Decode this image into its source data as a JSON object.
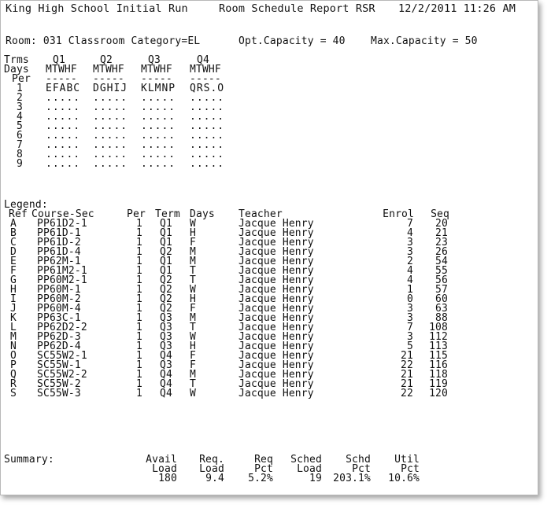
{
  "header": {
    "school": "King High School Initial Run",
    "report": "Room Schedule Report RSR",
    "datetime": "12/2/2011 11:26 AM"
  },
  "room_line": {
    "room": "Room: 031 Classroom Category=EL",
    "opt": "Opt.Capacity = 40",
    "max": "Max.Capacity = 50"
  },
  "grid": {
    "trms_label": "Trms",
    "days_label": "Days",
    "per_label": "Per",
    "terms": [
      "Q1",
      "Q2",
      "Q3",
      "Q4"
    ],
    "days": [
      "MTWHF",
      "MTWHF",
      "MTWHF",
      "MTWHF"
    ],
    "dashes": [
      "-----",
      "-----",
      "-----",
      "-----"
    ],
    "rows": [
      {
        "per": "1",
        "cells": [
          "EFABC",
          "DGHIJ",
          "KLMNP",
          "QRS.O"
        ]
      },
      {
        "per": "2",
        "cells": [
          ".....",
          ".....",
          ".....",
          "....."
        ]
      },
      {
        "per": "3",
        "cells": [
          ".....",
          ".....",
          ".....",
          "....."
        ]
      },
      {
        "per": "4",
        "cells": [
          ".....",
          ".....",
          ".....",
          "....."
        ]
      },
      {
        "per": "5",
        "cells": [
          ".....",
          ".....",
          ".....",
          "....."
        ]
      },
      {
        "per": "6",
        "cells": [
          ".....",
          ".....",
          ".....",
          "....."
        ]
      },
      {
        "per": "7",
        "cells": [
          ".....",
          ".....",
          ".....",
          "....."
        ]
      },
      {
        "per": "8",
        "cells": [
          ".....",
          ".....",
          ".....",
          "....."
        ]
      },
      {
        "per": "9",
        "cells": [
          ".....",
          ".....",
          ".....",
          "....."
        ]
      }
    ]
  },
  "legend": {
    "title": "Legend:",
    "headers": {
      "ref": "Ref",
      "course": "Course-Sec",
      "per": "Per",
      "term": "Term",
      "days": "Days",
      "teacher": "Teacher",
      "enrol": "Enrol",
      "seq": "Seq"
    },
    "rows": [
      {
        "ref": "A",
        "course": "PP61D2-1",
        "per": "1",
        "term": "Q1",
        "days": "W",
        "teacher": "Jacque Henry",
        "enrol": "7",
        "seq": "20"
      },
      {
        "ref": "B",
        "course": "PP61D-1",
        "per": "1",
        "term": "Q1",
        "days": "H",
        "teacher": "Jacque Henry",
        "enrol": "4",
        "seq": "21"
      },
      {
        "ref": "C",
        "course": "PP61D-2",
        "per": "1",
        "term": "Q1",
        "days": "F",
        "teacher": "Jacque Henry",
        "enrol": "3",
        "seq": "23"
      },
      {
        "ref": "D",
        "course": "PP61D-4",
        "per": "1",
        "term": "Q2",
        "days": "M",
        "teacher": "Jacque Henry",
        "enrol": "3",
        "seq": "26"
      },
      {
        "ref": "E",
        "course": "PP62M-1",
        "per": "1",
        "term": "Q1",
        "days": "M",
        "teacher": "Jacque Henry",
        "enrol": "2",
        "seq": "54"
      },
      {
        "ref": "F",
        "course": "PP61M2-1",
        "per": "1",
        "term": "Q1",
        "days": "T",
        "teacher": "Jacque Henry",
        "enrol": "4",
        "seq": "55"
      },
      {
        "ref": "G",
        "course": "PP60M2-1",
        "per": "1",
        "term": "Q2",
        "days": "T",
        "teacher": "Jacque Henry",
        "enrol": "4",
        "seq": "56"
      },
      {
        "ref": "H",
        "course": "PP60M-1",
        "per": "1",
        "term": "Q2",
        "days": "W",
        "teacher": "Jacque Henry",
        "enrol": "1",
        "seq": "57"
      },
      {
        "ref": "I",
        "course": "PP60M-2",
        "per": "1",
        "term": "Q2",
        "days": "H",
        "teacher": "Jacque Henry",
        "enrol": "0",
        "seq": "60"
      },
      {
        "ref": "J",
        "course": "PP60M-4",
        "per": "1",
        "term": "Q2",
        "days": "F",
        "teacher": "Jacque Henry",
        "enrol": "3",
        "seq": "63"
      },
      {
        "ref": "K",
        "course": "PP63C-1",
        "per": "1",
        "term": "Q3",
        "days": "M",
        "teacher": "Jacque Henry",
        "enrol": "3",
        "seq": "88"
      },
      {
        "ref": "L",
        "course": "PP62D2-2",
        "per": "1",
        "term": "Q3",
        "days": "T",
        "teacher": "Jacque Henry",
        "enrol": "7",
        "seq": "108"
      },
      {
        "ref": "M",
        "course": "PP62D-3",
        "per": "1",
        "term": "Q3",
        "days": "W",
        "teacher": "Jacque Henry",
        "enrol": "3",
        "seq": "112"
      },
      {
        "ref": "N",
        "course": "PP62D-4",
        "per": "1",
        "term": "Q3",
        "days": "H",
        "teacher": "Jacque Henry",
        "enrol": "5",
        "seq": "113"
      },
      {
        "ref": "O",
        "course": "SC55W2-1",
        "per": "1",
        "term": "Q4",
        "days": "F",
        "teacher": "Jacque Henry",
        "enrol": "21",
        "seq": "115"
      },
      {
        "ref": "P",
        "course": "SC55W-1",
        "per": "1",
        "term": "Q3",
        "days": "F",
        "teacher": "Jacque Henry",
        "enrol": "22",
        "seq": "116"
      },
      {
        "ref": "Q",
        "course": "SC55W2-2",
        "per": "1",
        "term": "Q4",
        "days": "M",
        "teacher": "Jacque Henry",
        "enrol": "21",
        "seq": "118"
      },
      {
        "ref": "R",
        "course": "SC55W-2",
        "per": "1",
        "term": "Q4",
        "days": "T",
        "teacher": "Jacque Henry",
        "enrol": "21",
        "seq": "119"
      },
      {
        "ref": "S",
        "course": "SC55W-3",
        "per": "1",
        "term": "Q4",
        "days": "W",
        "teacher": "Jacque Henry",
        "enrol": "22",
        "seq": "120"
      }
    ]
  },
  "summary": {
    "label": "Summary:",
    "columns": [
      {
        "h1": "Avail",
        "h2": "Load",
        "value": "180"
      },
      {
        "h1": "Req.",
        "h2": "Load",
        "value": "9.4"
      },
      {
        "h1": "Req",
        "h2": "Pct",
        "value": "5.2%"
      },
      {
        "h1": "Sched",
        "h2": "Load",
        "value": "19"
      },
      {
        "h1": "Schd",
        "h2": "Pct",
        "value": "203.1%"
      },
      {
        "h1": "Util",
        "h2": "Pct",
        "value": "10.6%"
      }
    ]
  }
}
